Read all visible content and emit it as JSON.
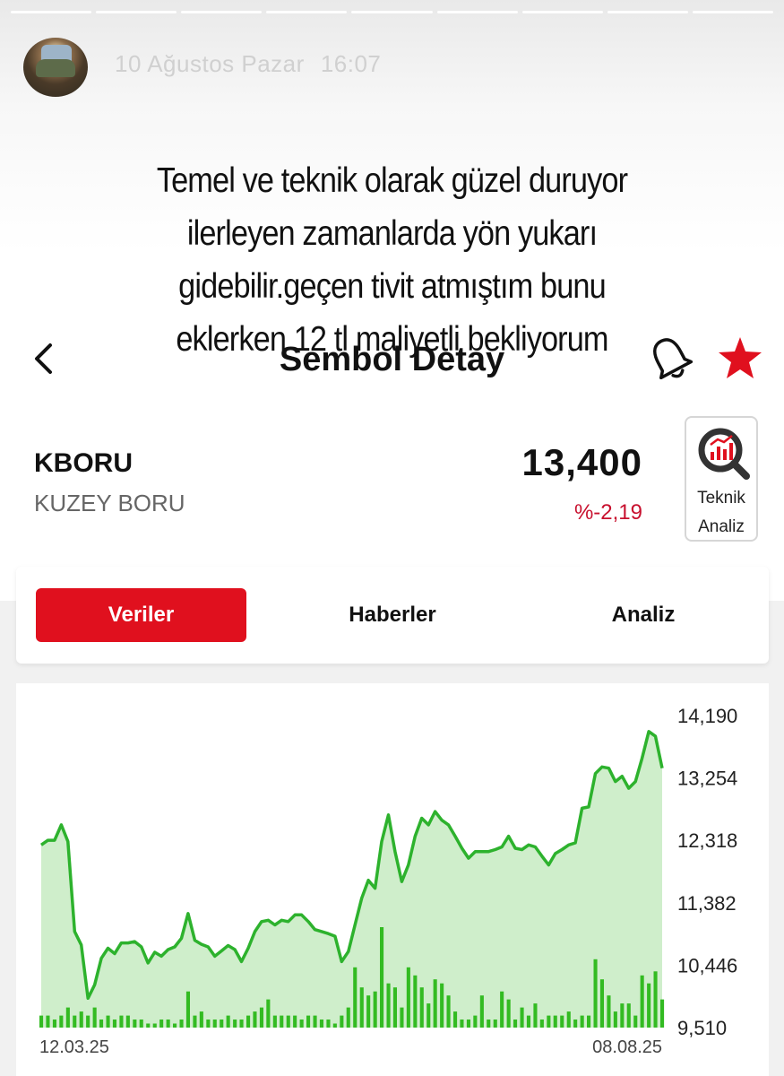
{
  "story": {
    "date": "10 Ağustos Pazar",
    "time": "16:07",
    "caption_lines": [
      "Temel ve teknik olarak güzel duruyor",
      "ilerleyen zamanlarda yön yukarı",
      "gidebilir.geçen tivit atmıştım bunu",
      "eklerken 12 tl maliyetli bekliyorum"
    ]
  },
  "header": {
    "title": "Sembol Detay",
    "back_icon": "chevron-left-icon",
    "alert_icon": "bell-icon",
    "favorite_icon": "star-icon",
    "favorite_color": "#e0101e"
  },
  "symbol": {
    "code": "KBORU",
    "name": "KUZEY BORU",
    "price": "13,400",
    "change": "%-2,19",
    "change_color": "#c8102e"
  },
  "teknik_button": {
    "line1": "Teknik",
    "line2": "Analiz",
    "icon": "analysis-magnifier-icon"
  },
  "tabs": [
    {
      "label": "Veriler",
      "active": true
    },
    {
      "label": "Haberler",
      "active": false
    },
    {
      "label": "Analiz",
      "active": false
    }
  ],
  "chart_data": {
    "type": "area",
    "line_color": "#2db22d",
    "fill_color": "#cfeecb",
    "volume_color": "#33bb22",
    "x_start_label": "12.03.25",
    "x_end_label": "08.08.25",
    "ylim": [
      9.51,
      14.19
    ],
    "y_ticks": [
      "14,190",
      "13,254",
      "12,318",
      "11,382",
      "10,446",
      "9,510"
    ],
    "price": [
      12.25,
      12.32,
      12.32,
      12.55,
      12.3,
      10.95,
      10.75,
      9.95,
      10.15,
      10.55,
      10.7,
      10.62,
      10.78,
      10.78,
      10.8,
      10.72,
      10.48,
      10.64,
      10.58,
      10.68,
      10.72,
      10.85,
      11.22,
      10.82,
      10.76,
      10.72,
      10.58,
      10.66,
      10.74,
      10.68,
      10.5,
      10.7,
      10.95,
      11.1,
      11.12,
      11.05,
      11.12,
      11.1,
      11.2,
      11.2,
      11.1,
      10.98,
      10.95,
      10.92,
      10.88,
      10.5,
      10.65,
      11.05,
      11.45,
      11.72,
      11.6,
      12.3,
      12.7,
      12.15,
      11.7,
      11.95,
      12.38,
      12.65,
      12.55,
      12.75,
      12.62,
      12.55,
      12.38,
      12.2,
      12.05,
      12.15,
      12.15,
      12.15,
      12.18,
      12.22,
      12.38,
      12.2,
      12.18,
      12.25,
      12.22,
      12.08,
      11.95,
      12.12,
      12.18,
      12.25,
      12.28,
      12.8,
      12.82,
      13.32,
      13.42,
      13.4,
      13.2,
      13.28,
      13.1,
      13.2,
      13.55,
      13.95,
      13.88,
      13.4
    ],
    "volume": [
      3,
      3,
      2,
      3,
      5,
      3,
      4,
      3,
      5,
      2,
      3,
      2,
      3,
      3,
      2,
      2,
      1,
      1,
      2,
      2,
      1,
      2,
      9,
      3,
      4,
      2,
      2,
      2,
      3,
      2,
      2,
      3,
      4,
      5,
      7,
      3,
      3,
      3,
      3,
      2,
      3,
      3,
      2,
      2,
      1,
      3,
      5,
      15,
      10,
      8,
      9,
      25,
      11,
      10,
      5,
      15,
      13,
      10,
      6,
      12,
      11,
      8,
      4,
      2,
      2,
      3,
      8,
      2,
      2,
      9,
      7,
      2,
      5,
      3,
      6,
      2,
      3,
      3,
      3,
      4,
      2,
      3,
      3,
      17,
      12,
      8,
      4,
      6,
      6,
      3,
      13,
      11,
      14,
      7
    ]
  }
}
